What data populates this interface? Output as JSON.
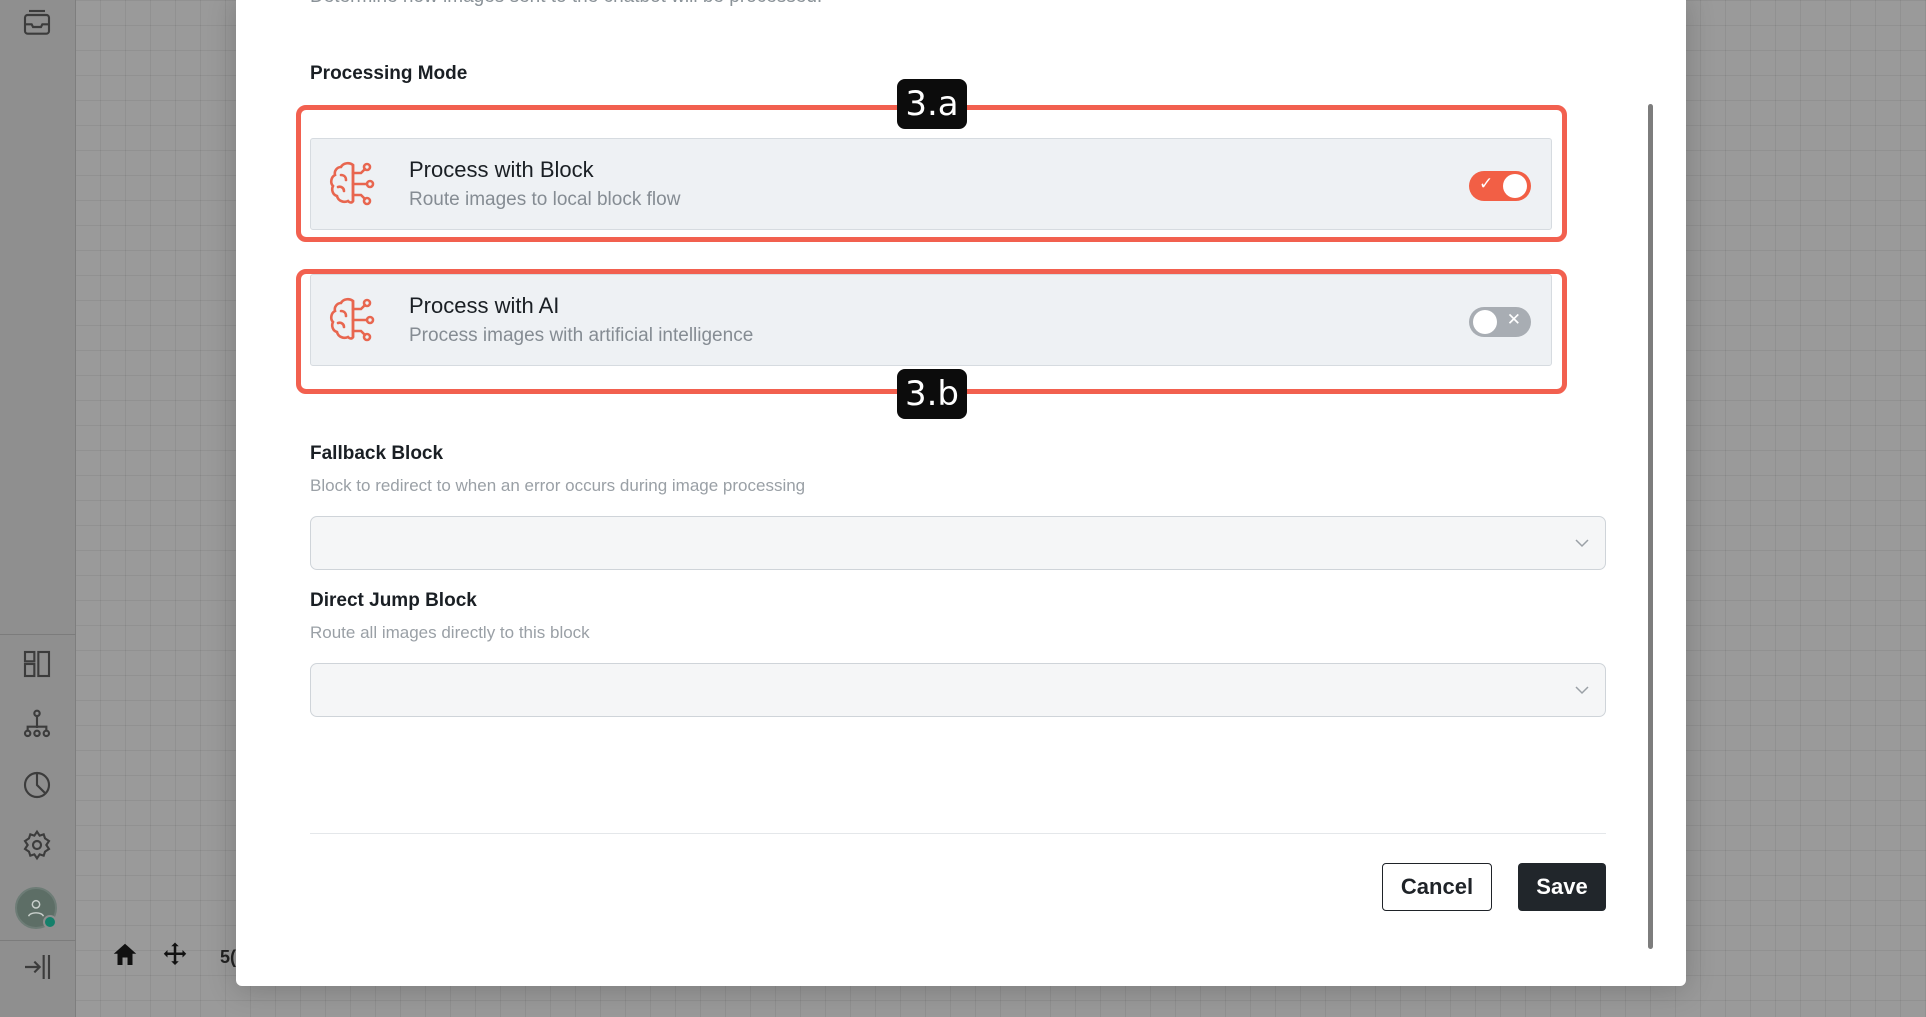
{
  "modal": {
    "top_description": "Determine how images sent to the chatbot will be processed.",
    "processing_mode_title": "Processing Mode",
    "options": [
      {
        "title": "Process with Block",
        "description": "Route images to local block flow",
        "enabled": true,
        "toggle_mark": "✓",
        "icon": "brain-circuit-icon"
      },
      {
        "title": "Process with AI",
        "description": "Process images with artificial intelligence",
        "enabled": false,
        "toggle_mark": "✕",
        "icon": "brain-circuit-icon"
      }
    ],
    "fallback": {
      "title": "Fallback Block",
      "help": "Block to redirect to when an error occurs during image processing",
      "value": ""
    },
    "direct_jump": {
      "title": "Direct Jump Block",
      "help": "Route all images directly to this block",
      "value": ""
    },
    "cancel_label": "Cancel",
    "save_label": "Save"
  },
  "annotations": {
    "label_a": "3.a",
    "label_b": "3.b",
    "color": "#f2604f"
  },
  "canvas": {
    "zoom_text": "5("
  },
  "colors": {
    "accent": "#f25f45",
    "primary_button": "#21262b"
  }
}
